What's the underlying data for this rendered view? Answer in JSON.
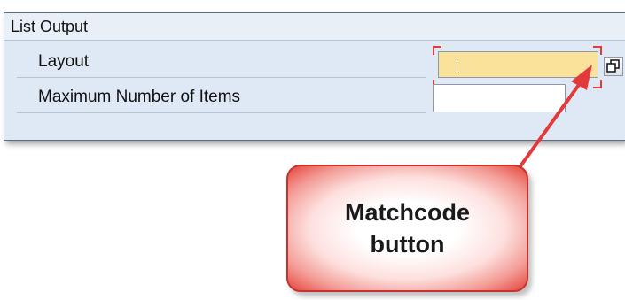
{
  "group": {
    "title": "List Output",
    "fields": [
      {
        "label": "Layout",
        "value": "",
        "focused": true,
        "background": "#fbe29b"
      },
      {
        "label": "Maximum Number of Items",
        "value": "",
        "background": "#ffffff"
      }
    ],
    "matchcode_icon": "matchcode-icon"
  },
  "annotation": {
    "line1": "Matchcode",
    "line2": "button",
    "accent_color": "#e23a3a"
  }
}
